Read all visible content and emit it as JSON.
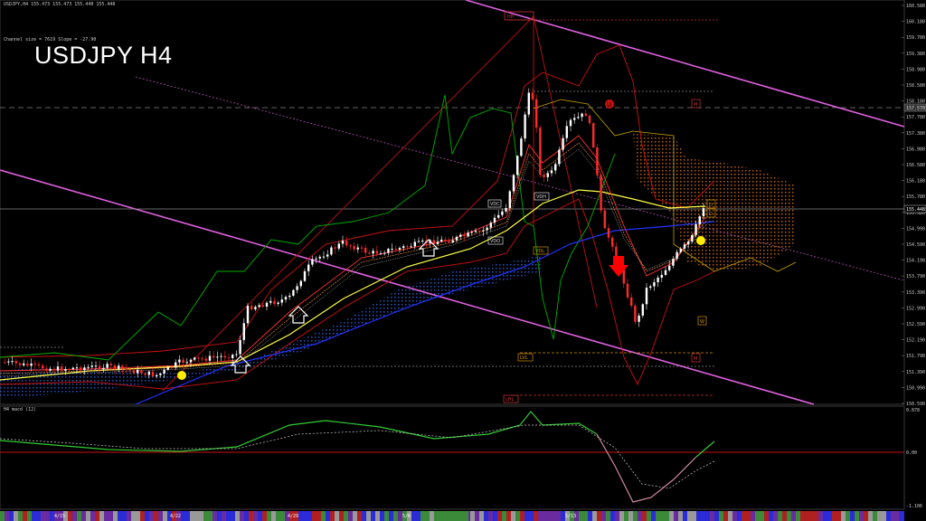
{
  "header": {
    "ohlc_line": "USDJPY,H4  155.473 155.473 155.440 155.448",
    "channel_info": "Channel size = 7619 Slope = -27.90",
    "symbol_title": "USDJPY H4"
  },
  "chart_data": [
    {
      "type": "candlestick",
      "title": "USDJPY H4",
      "price_ticks": [
        "160.580",
        "160.180",
        "159.780",
        "159.380",
        "158.980",
        "158.580",
        "158.180",
        "157.780",
        "157.380",
        "156.980",
        "156.580",
        "156.180",
        "155.780",
        "155.380",
        "154.990",
        "154.590",
        "154.190",
        "153.790",
        "153.390",
        "152.990",
        "152.590",
        "152.190",
        "151.790",
        "151.390",
        "150.990",
        "150.590"
      ],
      "ylim": [
        150.59,
        160.58
      ],
      "current_price": "155.448",
      "marked_level": "157.570",
      "date_labels": [
        "4/15",
        "4/22",
        "4/29",
        "5/6",
        "5/13"
      ],
      "annotations": [
        "HH",
        "UHL",
        "VDC",
        "VDH",
        "VDO",
        "VDL",
        "LVL",
        "LHL",
        "W",
        "M",
        "D",
        "U"
      ],
      "colors": {
        "bull_candle": "#ffffff",
        "bear_candle": "#ff2a2a",
        "ema_yellow": "#ffff44",
        "ema_blue": "#2233ff",
        "bollinger": "#cc1111",
        "ichimoku_green": "#00b000",
        "channel": "#ff66ff",
        "cloud": "#ff8a00",
        "arrow_up": "#ffffff",
        "arrow_down": "#ff0000"
      }
    },
    {
      "type": "line",
      "title": "H4 macd (12)",
      "y_ticks": [
        "0.878",
        "0.00",
        "-1.106"
      ],
      "ylim": [
        -1.106,
        0.878
      ],
      "series": [
        {
          "name": "macd",
          "color": "#33cc33"
        },
        {
          "name": "signal",
          "color": "#cccccc"
        }
      ]
    }
  ]
}
